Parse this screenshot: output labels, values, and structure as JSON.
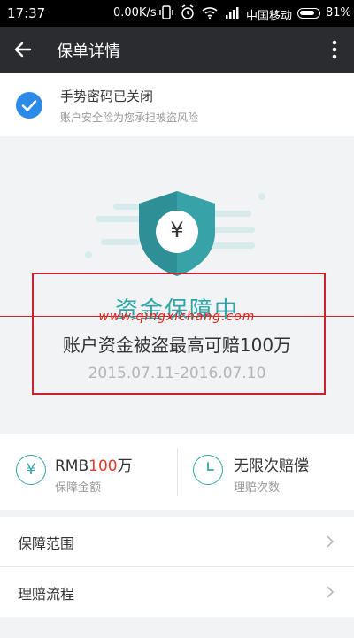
{
  "status_bar": {
    "time": "17:37",
    "network_speed": "0.00K/s",
    "carrier": "中国移动",
    "battery": "81%"
  },
  "header": {
    "title": "保单详情"
  },
  "notice": {
    "title": "手势密码已关闭",
    "subtitle": "账户安全险为您承担被盗风险"
  },
  "policy": {
    "currency_symbol": "¥",
    "status": "资金保障中",
    "watermark": "www.qingxichang.com",
    "claim_text": "账户资金被盗最高可赔100万",
    "period": "2015.07.11-2016.07.10"
  },
  "stats": {
    "coverage": {
      "icon": "yen-circle-icon",
      "prefix": "RMB",
      "amount": "100",
      "unit": "万",
      "label": "保障金额"
    },
    "claims": {
      "icon": "clock-circle-icon",
      "value": "无限次赔偿",
      "label": "理赔次数"
    }
  },
  "menu": [
    {
      "label": "保障范围"
    },
    {
      "label": "理赔流程"
    }
  ],
  "colors": {
    "accent_teal": "#2ea6a8",
    "highlight_red": "#e23b2b",
    "check_blue": "#2b8ae6",
    "header_bg": "#2a2c30"
  }
}
